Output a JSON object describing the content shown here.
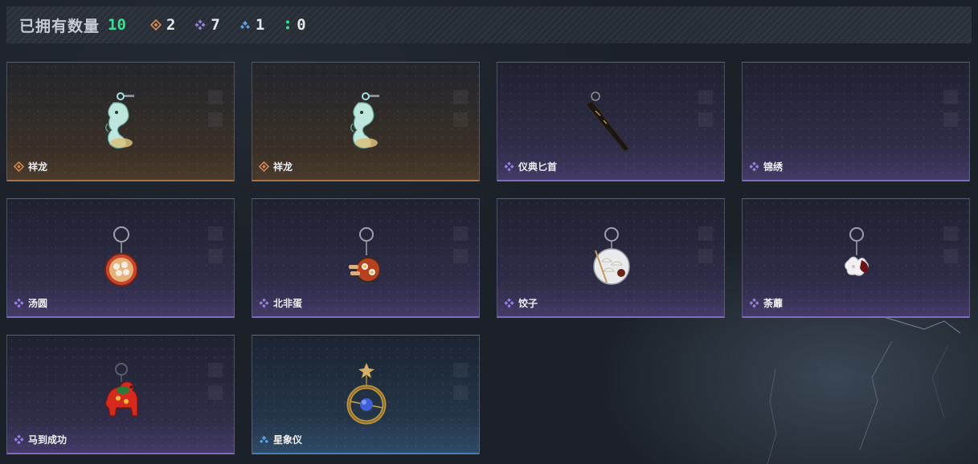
{
  "header": {
    "owned_label": "已拥有数量",
    "owned_count": "10",
    "stats": [
      {
        "rarity": "orange",
        "icon": "orange-diamond-icon",
        "count": "2"
      },
      {
        "rarity": "purple",
        "icon": "purple-diamond-icon",
        "count": "7"
      },
      {
        "rarity": "blue",
        "icon": "blue-diamond-icon",
        "count": "1"
      },
      {
        "rarity": "green",
        "icon": "green-dots-icon",
        "count": "0"
      }
    ]
  },
  "colors": {
    "orange": "#d98a52",
    "purple": "#9b7fe0",
    "blue": "#5c9ee0",
    "green": "#36e08c"
  },
  "items": [
    {
      "name": "祥龙",
      "rarity": "orange",
      "icon": "dragon-charm-icon"
    },
    {
      "name": "祥龙",
      "rarity": "orange",
      "icon": "dragon-charm-icon"
    },
    {
      "name": "仪典匕首",
      "rarity": "purple",
      "icon": "ceremonial-dagger-icon"
    },
    {
      "name": "锦绣",
      "rarity": "purple",
      "icon": ""
    },
    {
      "name": "汤圆",
      "rarity": "purple",
      "icon": "tangyuan-bowl-charm-icon"
    },
    {
      "name": "北非蛋",
      "rarity": "purple",
      "icon": "shakshuka-pan-charm-icon"
    },
    {
      "name": "饺子",
      "rarity": "purple",
      "icon": "dumpling-plate-charm-icon"
    },
    {
      "name": "荼蘼",
      "rarity": "purple",
      "icon": "flower-charm-icon"
    },
    {
      "name": "马到成功",
      "rarity": "purple",
      "icon": "red-horse-charm-icon"
    },
    {
      "name": "星象仪",
      "rarity": "blue",
      "icon": "astrolabe-charm-icon"
    }
  ]
}
